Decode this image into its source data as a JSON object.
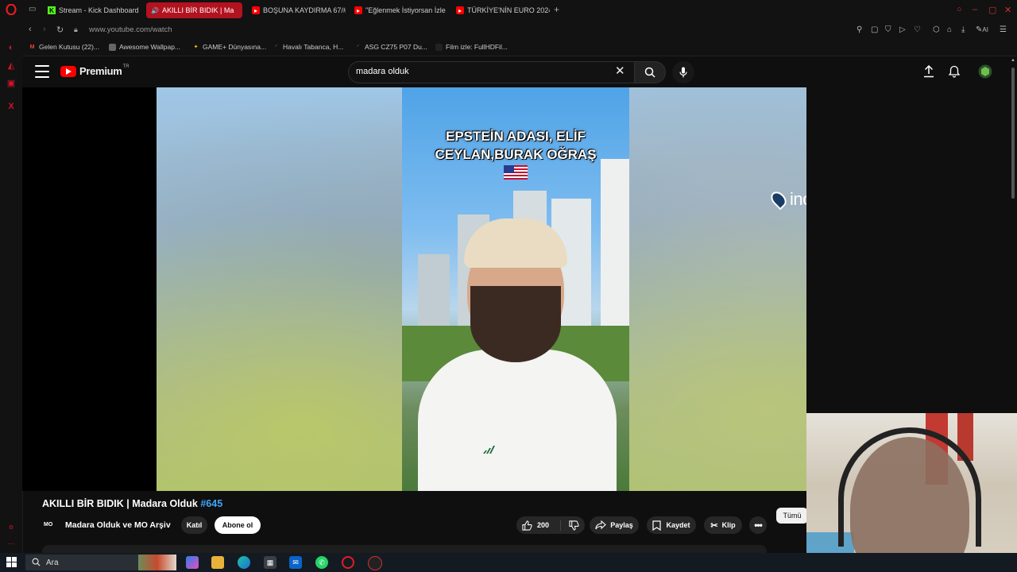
{
  "browser": {
    "tabs": [
      {
        "label": "Stream - Kick Dashboard",
        "icon": "kick-icon",
        "active": false
      },
      {
        "label": "AKILLI BİR BIDIK | Ma",
        "icon": "youtube-icon",
        "active": true
      },
      {
        "label": "BOŞUNA KAYDIRMA 67/#",
        "icon": "youtube-icon",
        "active": false
      },
      {
        "label": "\"Eğlenmek İstiyorsan İzle",
        "icon": "youtube-icon",
        "active": false
      },
      {
        "label": "TÜRKİYE'NİN EURO 2024",
        "icon": "youtube-icon",
        "active": false
      }
    ],
    "new_tab_label": "+",
    "url": "www.youtube.com/watch",
    "bookmarks": [
      {
        "label": "Gelen Kutusu (22)...",
        "icon": "gmail-icon"
      },
      {
        "label": "Awesome Wallpap...",
        "icon": "bookmark-icon"
      },
      {
        "label": "GAME+ Dünyasına...",
        "icon": "star-icon"
      },
      {
        "label": "Havalı Tabanca, H...",
        "icon": "bookmark-icon"
      },
      {
        "label": "ASG CZ75 P07 Du...",
        "icon": "bookmark-icon"
      },
      {
        "label": "Film izle: FullHDFil...",
        "icon": "bookmark-icon"
      }
    ],
    "ai_label": "AI"
  },
  "youtube": {
    "logo_text": "Premium",
    "logo_country": "TR",
    "search_value": "madara olduk",
    "video": {
      "caption_line1": "EPSTEİN ADASI, ELİF",
      "caption_line2": "CEYLAN,BURAK OĞRAŞ",
      "watermark": "inovapin",
      "title": "AKILLI BİR BIDIK | Madara Olduk ",
      "hashtag": "#645",
      "channel_avatar_text": "MO",
      "channel_name": "Madara Olduk ve MO Arşiv",
      "join_label": "Katıl",
      "subscribe_label": "Abone ol",
      "like_count": "200",
      "share_label": "Paylaş",
      "save_label": "Kaydet",
      "clip_label": "Klip",
      "all_chip_label": "Tümü"
    },
    "accent_color": "#ff0000",
    "link_color": "#3ea6ff"
  },
  "taskbar": {
    "search_label": "Ara"
  }
}
